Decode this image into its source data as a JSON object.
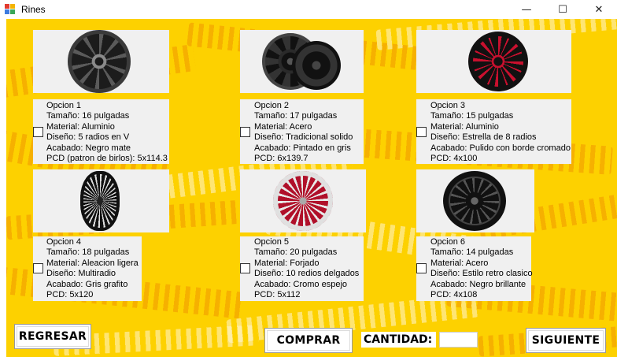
{
  "window": {
    "title": "Rines",
    "controls": {
      "minimize": "—",
      "maximize": "☐",
      "close": "✕"
    }
  },
  "options": [
    {
      "lines": [
        "Opcion 1",
        "Tamaño: 16 pulgadas",
        "Material: Aluminio",
        "Diseño: 5 radios en V",
        "Acabado: Negro mate",
        "PCD (patron de birlos): 5x114.3"
      ],
      "image": "wheel-alloy-silver-5-v-spoke"
    },
    {
      "lines": [
        "Opcion 2",
        "Tamaño: 17 pulgadas",
        "Material: Acero",
        "Diseño: Tradicional solido",
        "Acabado: Pintado en gris",
        "PCD: 6x139.7"
      ],
      "image": "wheel-steel-black"
    },
    {
      "lines": [
        "Opcion 3",
        "Tamaño: 15 pulgadas",
        "Material: Aluminio",
        "Diseño: Estrella de 8 radios",
        "Acabado: Pulido con borde cromado",
        "PCD: 4x100"
      ],
      "image": "wheel-black-red-8-spoke"
    },
    {
      "lines": [
        "Opcion 4",
        "Tamaño: 18 pulgadas",
        "Material: Aleacion ligera",
        "Diseño: Multiradio",
        "Acabado: Gris grafito",
        "PCD: 5x120"
      ],
      "image": "wheel-multispoke-black"
    },
    {
      "lines": [
        "Opcion 5",
        "Tamaño: 20 pulgadas",
        "Material: Forjado",
        "Diseño: 10 redios delgados",
        "Acabado: Cromo espejo",
        "PCD: 5x112"
      ],
      "image": "wheel-chrome-red"
    },
    {
      "lines": [
        "Opcion 6",
        "Tamaño: 14 pulgadas",
        "Material: Acero",
        "Diseño: Estilo retro clasico",
        "Acabado: Negro brillante",
        "PCD: 4x108"
      ],
      "image": "wheel-steel-retro-black"
    }
  ],
  "buttons": {
    "back": "REGRESAR",
    "buy": "COMPRAR",
    "next": "SIGUIENTE"
  },
  "quantity": {
    "label": "CANTIDAD:",
    "value": ""
  }
}
